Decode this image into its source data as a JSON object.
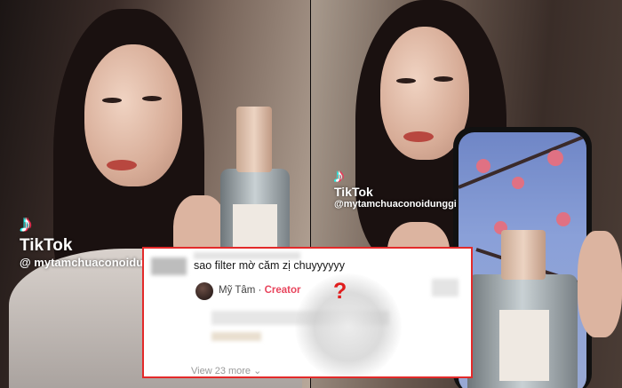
{
  "watermark_left": {
    "brand": "TikTok",
    "handle": "@ mytamchuaconoidunggi"
  },
  "watermark_right": {
    "brand": "TikTok",
    "handle": "@mytamchuaconoidunggi"
  },
  "comment": {
    "text": "sao filter mờ căm zị chuyyyyyy"
  },
  "reply": {
    "author": "Mỹ Tâm",
    "separator": " · ",
    "role": "Creator"
  },
  "annotation": {
    "question_mark": "?"
  },
  "view_more": {
    "label": "View 23 more",
    "chevron": "⌄"
  },
  "colors": {
    "highlight_border": "#e32a2a",
    "creator_tag": "#e8455d",
    "question_mark": "#e01d1d"
  }
}
